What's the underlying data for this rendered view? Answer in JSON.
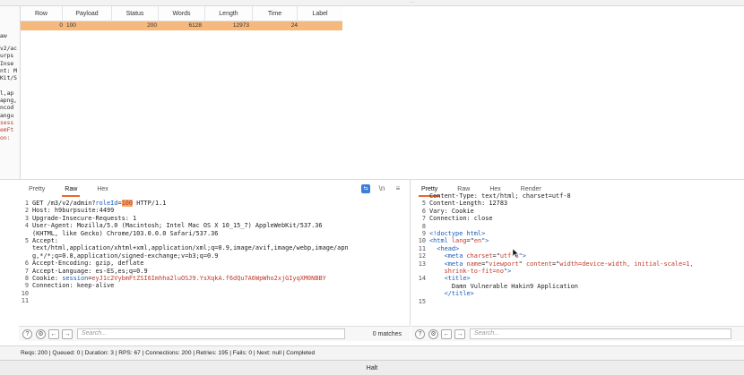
{
  "results_table": {
    "columns": [
      "Row",
      "Payload",
      "Status",
      "Words",
      "Length",
      "Time",
      "Label"
    ],
    "row": {
      "row": "0",
      "payload": "100",
      "status": "200",
      "words": "6128",
      "length": "12973",
      "time": "24",
      "label": ""
    },
    "row_color": "#f5b97e"
  },
  "left_pane": {
    "tab": "aw",
    "lines": [
      "v2/ac",
      "urps",
      "Inse",
      "nt: M",
      "Kit/S",
      "",
      "l,ap",
      "apng,",
      "ncod",
      "angu",
      "sess",
      "emFt",
      "on: "
    ]
  },
  "request": {
    "tabs": [
      "Pretty",
      "Raw",
      "Hex"
    ],
    "active_tab": "Raw",
    "icons": [
      "wrap-icon",
      "newline-icon",
      "menu-icon"
    ],
    "icon_glyphs": {
      "wrap": "⇆",
      "newline": "\\n",
      "menu": "≡"
    },
    "lines": [
      {
        "n": "1",
        "parts": [
          {
            "t": "GET /m3/v2/admin?",
            "c": ""
          },
          {
            "t": "roleId",
            "c": "blue"
          },
          {
            "t": "=",
            "c": ""
          },
          {
            "t": "100",
            "c": "hl"
          },
          {
            "t": " HTTP/1.1",
            "c": ""
          }
        ]
      },
      {
        "n": "2",
        "parts": [
          {
            "t": "Host: h9burpsuite:4499",
            "c": ""
          }
        ]
      },
      {
        "n": "3",
        "parts": [
          {
            "t": "Upgrade-Insecure-Requests: 1",
            "c": ""
          }
        ]
      },
      {
        "n": "4",
        "parts": [
          {
            "t": "User-Agent: Mozilla/5.0 (Macintosh; Intel Mac OS X 10_15_7) AppleWebKit/537.36",
            "c": ""
          }
        ]
      },
      {
        "n": "",
        "parts": [
          {
            "t": "(KHTML, like Gecko) Chrome/103.0.0.0 Safari/537.36",
            "c": ""
          }
        ]
      },
      {
        "n": "5",
        "parts": [
          {
            "t": "Accept:",
            "c": ""
          }
        ]
      },
      {
        "n": "",
        "parts": [
          {
            "t": "text/html,application/xhtml+xml,application/xml;q=0.9,image/avif,image/webp,image/apn",
            "c": ""
          }
        ]
      },
      {
        "n": "",
        "parts": [
          {
            "t": "g,*/*;q=0.8,application/signed-exchange;v=b3;q=0.9",
            "c": ""
          }
        ]
      },
      {
        "n": "6",
        "parts": [
          {
            "t": "Accept-Encoding: gzip, deflate",
            "c": ""
          }
        ]
      },
      {
        "n": "7",
        "parts": [
          {
            "t": "Accept-Language: es-ES,es;q=0.9",
            "c": ""
          }
        ]
      },
      {
        "n": "8",
        "parts": [
          {
            "t": "Cookie: ",
            "c": ""
          },
          {
            "t": "session",
            "c": "blue"
          },
          {
            "t": "=",
            "c": ""
          },
          {
            "t": "eyJ1c2VybmFtZSI6Imhha2luOSJ9.YsXqkA.f6dQu7A6WpWho2xjGIyqXM0NBBY",
            "c": "red"
          }
        ]
      },
      {
        "n": "9",
        "parts": [
          {
            "t": "Connection: keep-alive",
            "c": ""
          }
        ]
      },
      {
        "n": "10",
        "parts": [
          {
            "t": "",
            "c": ""
          }
        ]
      },
      {
        "n": "11",
        "parts": [
          {
            "t": "",
            "c": ""
          }
        ]
      }
    ],
    "search_placeholder": "Search...",
    "matches": "0 matches"
  },
  "response": {
    "tabs": [
      "Pretty",
      "Raw",
      "Hex",
      "Render"
    ],
    "active_tab": "Pretty",
    "lines": [
      {
        "n": "",
        "parts": [
          {
            "t": "Content-Type: text/html; charset=utf-8",
            "c": ""
          }
        ]
      },
      {
        "n": "5",
        "parts": [
          {
            "t": "Content-Length: 12783",
            "c": ""
          }
        ]
      },
      {
        "n": "6",
        "parts": [
          {
            "t": "Vary: Cookie",
            "c": ""
          }
        ]
      },
      {
        "n": "7",
        "parts": [
          {
            "t": "Connection: close",
            "c": ""
          }
        ]
      },
      {
        "n": "8",
        "parts": [
          {
            "t": "",
            "c": ""
          }
        ]
      },
      {
        "n": "9",
        "parts": [
          {
            "t": "<!doctype html>",
            "c": "blue"
          }
        ]
      },
      {
        "n": "10",
        "parts": [
          {
            "t": "<html ",
            "c": "blue"
          },
          {
            "t": "lang",
            "c": "red"
          },
          {
            "t": "=\"",
            "c": ""
          },
          {
            "t": "en",
            "c": "red"
          },
          {
            "t": "\">",
            "c": "blue"
          }
        ]
      },
      {
        "n": "11",
        "parts": [
          {
            "t": "  <head>",
            "c": "blue"
          }
        ]
      },
      {
        "n": "12",
        "parts": [
          {
            "t": "    <meta ",
            "c": "blue"
          },
          {
            "t": "charset",
            "c": "red"
          },
          {
            "t": "=\"",
            "c": ""
          },
          {
            "t": "utf-8",
            "c": "red"
          },
          {
            "t": "\">",
            "c": "blue"
          }
        ]
      },
      {
        "n": "13",
        "parts": [
          {
            "t": "    <meta ",
            "c": "blue"
          },
          {
            "t": "name",
            "c": "red"
          },
          {
            "t": "=\"",
            "c": ""
          },
          {
            "t": "viewport",
            "c": "red"
          },
          {
            "t": "\" ",
            "c": ""
          },
          {
            "t": "content",
            "c": "red"
          },
          {
            "t": "=\"",
            "c": ""
          },
          {
            "t": "width=device-width, initial-scale=1,",
            "c": "red"
          }
        ]
      },
      {
        "n": "",
        "parts": [
          {
            "t": "    shrink-to-fit=no",
            "c": "red"
          },
          {
            "t": "\">",
            "c": "blue"
          }
        ]
      },
      {
        "n": "14",
        "parts": [
          {
            "t": "    <title>",
            "c": "blue"
          }
        ]
      },
      {
        "n": "",
        "parts": [
          {
            "t": "      Damn Vulnerable Hakin9 Application",
            "c": ""
          }
        ]
      },
      {
        "n": "",
        "parts": [
          {
            "t": "    </title>",
            "c": "blue"
          }
        ]
      },
      {
        "n": "15",
        "parts": [
          {
            "t": "",
            "c": ""
          }
        ]
      }
    ],
    "search_placeholder": "Search..."
  },
  "status_bar": "Reqs: 200 | Queued: 0 | Duration: 3 | RPS: 67 | Connections: 200 | Retries: 195 | Fails: 0 | Next: null | Completed",
  "halt_label": "Halt",
  "colors": {
    "accent": "#e8692c",
    "highlight": "#f0a96a",
    "keyword_blue": "#1a5bb8",
    "value_red": "#c0392b",
    "wrap_icon_blue": "#3b7dd8"
  },
  "search_icons": {
    "help": "?",
    "settings": "⚙",
    "prev": "←",
    "next": "→"
  }
}
